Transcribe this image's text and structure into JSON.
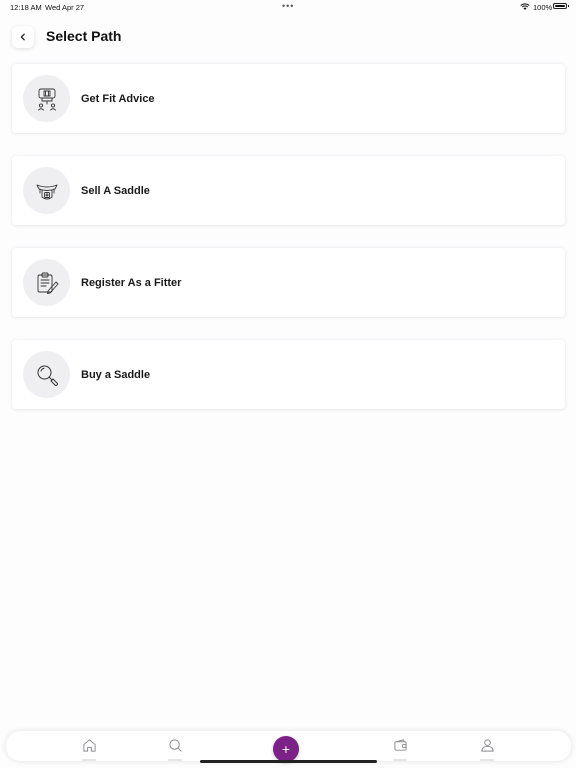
{
  "status_bar": {
    "time": "12:18 AM",
    "date": "Wed Apr 27",
    "dots": "•••",
    "battery_percent": "100%",
    "battery_level": 1.0
  },
  "header": {
    "title": "Select Path",
    "back_icon": "chevron-left-icon"
  },
  "options": [
    {
      "label": "Get Fit Advice",
      "icon": "horse-saddle-fit-icon"
    },
    {
      "label": "Sell A Saddle",
      "icon": "saddle-icon"
    },
    {
      "label": "Register As a Fitter",
      "icon": "clipboard-pencil-icon"
    },
    {
      "label": "Buy a Saddle",
      "icon": "magnifier-icon"
    }
  ],
  "tab_bar": {
    "items": [
      "home-icon",
      "search-icon",
      "add-icon",
      "wallet-icon",
      "profile-icon"
    ],
    "add_label": "+"
  },
  "colors": {
    "accent": "#7b2188",
    "background": "#fdfdfe",
    "icon_circle": "#efeff1"
  }
}
